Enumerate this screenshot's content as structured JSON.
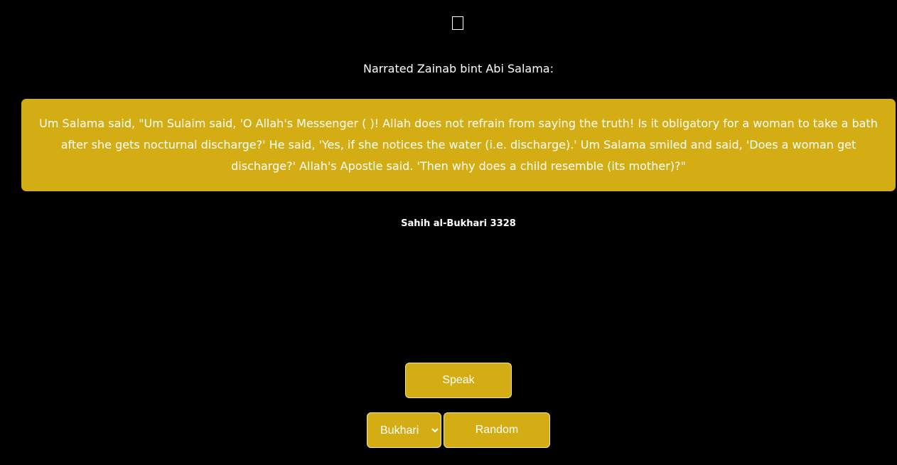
{
  "hadith": {
    "narrator": "Narrated Zainab bint Abi Salama:",
    "text": "Um Salama said, \"Um Sulaim said, 'O Allah's Messenger ( )! Allah does not refrain from saying the truth! Is it obligatory for a woman to take a bath after she gets nocturnal discharge?' He said, 'Yes, if she notices the water (i.e. discharge).' Um Salama smiled and said, 'Does a woman get discharge?' Allah's Apostle said. 'Then why does a child resemble (its mother)?\"",
    "reference": "Sahih al-Bukhari 3328"
  },
  "controls": {
    "speak_label": "Speak",
    "random_label": "Random",
    "collection": {
      "selected": "Bukhari",
      "options": [
        "Bukhari"
      ]
    }
  },
  "colors": {
    "background": "#000000",
    "accent": "#d4ac14",
    "text": "#ffffff"
  }
}
